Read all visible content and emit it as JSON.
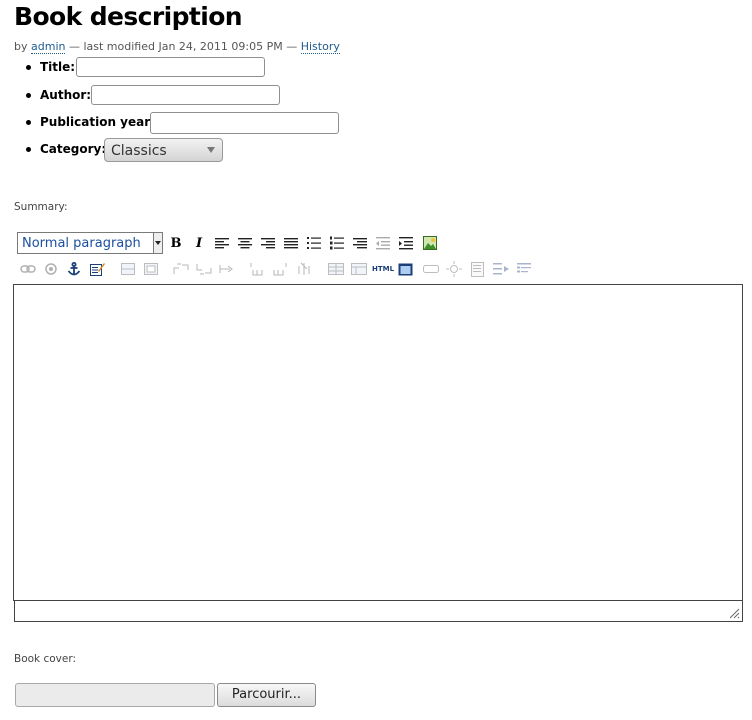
{
  "page": {
    "title": "Book description",
    "byline": {
      "prefix": "by",
      "author": "admin",
      "modified": "— last modified Jan 24, 2011 09:05 PM —",
      "history": "History"
    }
  },
  "form": {
    "fields": [
      {
        "label": "Title:",
        "value": ""
      },
      {
        "label": "Author:",
        "value": ""
      },
      {
        "label": "Publication year:",
        "value": ""
      },
      {
        "label": "Category:",
        "value": "Classics"
      }
    ],
    "summary_label": "Summary:",
    "book_cover_label": "Book cover:",
    "browse_button": "Parcourir...",
    "file_value": ""
  },
  "editor": {
    "format_select": "Normal paragraph",
    "toolbar_row1": [
      "bold",
      "italic",
      "align-left",
      "align-center",
      "align-right",
      "align-justify",
      "bullet-list",
      "numbered-list",
      "definition-list",
      "outdent",
      "indent",
      "image"
    ],
    "toolbar_row2": [
      "link",
      "unlink",
      "anchor",
      "edit-properties",
      "table-insert",
      "table-properties",
      "row-before",
      "row-after",
      "row-delete",
      "col-before",
      "col-after",
      "col-delete",
      "merge-cells",
      "split-cells",
      "html-source",
      "fullscreen",
      "field",
      "toggle",
      "page",
      "insert-below",
      "list-settings"
    ],
    "html_label": "HTML",
    "content": ""
  }
}
